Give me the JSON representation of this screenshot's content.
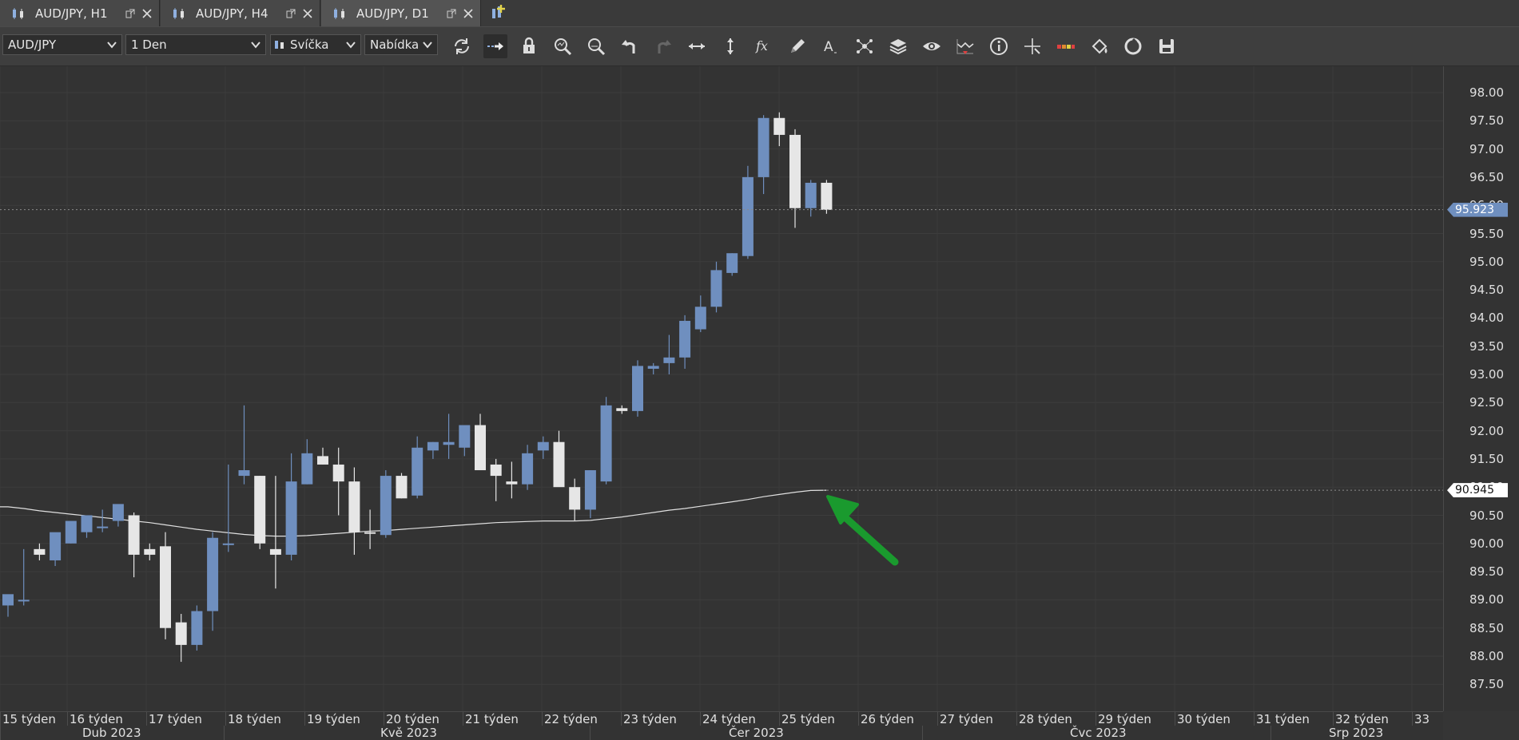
{
  "tabs": [
    {
      "label": "AUD/JPY, H1",
      "active": false
    },
    {
      "label": "AUD/JPY, H4",
      "active": false
    },
    {
      "label": "AUD/JPY, D1",
      "active": true
    }
  ],
  "toolbar": {
    "instrument": "AUD/JPY",
    "period": "1 Den",
    "chart_type": "Svíčka",
    "offer_side": "Nabídka",
    "tools": [
      "refresh-icon",
      "shift-chart-icon",
      "lock-icon",
      "zoom-in-icon",
      "zoom-out-icon",
      "undo-icon",
      "redo-icon",
      "horizontal-scale-icon",
      "vertical-scale-icon",
      "indicators-fx-icon",
      "drawing-pencil-icon",
      "text-tool-icon",
      "pattern-icon",
      "layers-icon",
      "visibility-eye-icon",
      "signals-icon",
      "info-icon",
      "crosshair-icon",
      "colors-icon",
      "theme-icon",
      "template-icon",
      "save-icon"
    ]
  },
  "price_axis": {
    "labels": [
      "98.00",
      "97.50",
      "97.00",
      "96.50",
      "96.00",
      "95.50",
      "95.00",
      "94.50",
      "94.00",
      "93.50",
      "93.00",
      "92.50",
      "92.00",
      "91.50",
      "91.00",
      "90.50",
      "90.00",
      "89.50",
      "89.00",
      "88.50",
      "88.00",
      "87.50"
    ],
    "current_price": "95.923",
    "ma_value": "90.945"
  },
  "time_axis": {
    "weeks": [
      "15 týden",
      "16 týden",
      "17 týden",
      "18 týden",
      "19 týden",
      "20 týden",
      "21 týden",
      "22 týden",
      "23 týden",
      "24 týden",
      "25 týden",
      "26 týden",
      "27 týden",
      "28 týden",
      "29 týden",
      "30 týden",
      "31 týden",
      "32 týden",
      "33"
    ],
    "months": [
      "Dub 2023",
      "Kvě 2023",
      "Čer 2023",
      "Čvc 2023",
      "Srp 2023"
    ]
  },
  "colors": {
    "bull": "#6f8fbf",
    "bear": "#e6e6e6",
    "ma_line": "#e0e0e0",
    "arrow": "#1a9a2e",
    "current_tag": "#6f8fbf"
  },
  "chart_data": {
    "type": "candlestick",
    "instrument": "AUD/JPY",
    "timeframe": "D1",
    "ylim": [
      87.25,
      98.3
    ],
    "ohlc": [
      [
        88.9,
        89.0,
        88.7,
        89.1
      ],
      [
        89.0,
        89.9,
        88.9,
        89.0
      ],
      [
        89.9,
        90.0,
        89.7,
        89.8
      ],
      [
        89.7,
        90.1,
        89.6,
        90.2
      ],
      [
        90.0,
        90.2,
        90.0,
        90.4
      ],
      [
        90.2,
        90.5,
        90.1,
        90.5
      ],
      [
        90.3,
        90.6,
        90.2,
        90.3
      ],
      [
        90.4,
        90.5,
        90.3,
        90.7
      ],
      [
        90.5,
        90.55,
        89.4,
        89.8
      ],
      [
        89.8,
        90.0,
        89.7,
        89.9
      ],
      [
        89.95,
        90.2,
        88.3,
        88.5
      ],
      [
        88.6,
        88.75,
        87.9,
        88.2
      ],
      [
        88.2,
        88.9,
        88.1,
        88.8
      ],
      [
        88.8,
        90.2,
        88.45,
        90.1
      ],
      [
        90.0,
        91.4,
        89.85,
        90.0
      ],
      [
        91.3,
        92.45,
        91.05,
        91.2
      ],
      [
        91.2,
        91.2,
        89.9,
        90.0
      ],
      [
        89.8,
        91.2,
        89.2,
        89.9
      ],
      [
        89.8,
        91.6,
        89.7,
        91.1
      ],
      [
        91.05,
        91.85,
        91.05,
        91.6
      ],
      [
        91.55,
        91.7,
        91.4,
        91.4
      ],
      [
        91.4,
        91.7,
        90.5,
        91.1
      ],
      [
        91.1,
        91.35,
        89.8,
        90.2
      ],
      [
        90.2,
        90.6,
        89.9,
        90.2
      ],
      [
        90.15,
        91.3,
        90.1,
        91.2
      ],
      [
        91.2,
        91.25,
        90.8,
        90.8
      ],
      [
        90.85,
        91.9,
        90.8,
        91.7
      ],
      [
        91.65,
        91.8,
        91.5,
        91.8
      ],
      [
        91.8,
        92.3,
        91.5,
        91.75
      ],
      [
        91.7,
        91.95,
        91.55,
        92.1
      ],
      [
        92.1,
        92.3,
        91.7,
        91.3
      ],
      [
        91.4,
        91.5,
        90.75,
        91.2
      ],
      [
        91.1,
        91.45,
        90.8,
        91.05
      ],
      [
        91.05,
        91.75,
        90.95,
        91.6
      ],
      [
        91.65,
        91.9,
        91.5,
        91.8
      ],
      [
        91.8,
        92.0,
        91.6,
        91.0
      ],
      [
        91.0,
        91.15,
        90.4,
        90.6
      ],
      [
        90.6,
        91.3,
        90.45,
        91.3
      ],
      [
        91.1,
        92.6,
        91.05,
        92.45
      ],
      [
        92.4,
        92.45,
        92.3,
        92.35
      ],
      [
        92.35,
        93.25,
        92.25,
        93.15
      ],
      [
        93.1,
        93.2,
        93.0,
        93.15
      ],
      [
        93.2,
        93.7,
        93.0,
        93.3
      ],
      [
        93.3,
        94.05,
        93.1,
        93.95
      ],
      [
        93.8,
        94.4,
        93.75,
        94.2
      ],
      [
        94.2,
        95.0,
        94.1,
        94.85
      ],
      [
        94.8,
        95.15,
        94.75,
        95.15
      ],
      [
        95.1,
        96.7,
        95.05,
        96.5
      ],
      [
        96.5,
        97.6,
        96.2,
        97.55
      ],
      [
        97.55,
        97.65,
        97.05,
        97.25
      ],
      [
        97.25,
        97.35,
        95.6,
        95.95
      ],
      [
        95.95,
        96.45,
        95.8,
        96.4
      ],
      [
        96.4,
        96.45,
        95.85,
        95.92
      ]
    ],
    "bull_flags": [
      1,
      1,
      0,
      1,
      1,
      1,
      1,
      1,
      0,
      0,
      0,
      0,
      1,
      1,
      1,
      1,
      0,
      0,
      1,
      1,
      0,
      0,
      0,
      0,
      1,
      0,
      1,
      1,
      1,
      1,
      0,
      0,
      0,
      1,
      1,
      0,
      0,
      1,
      1,
      0,
      1,
      1,
      1,
      1,
      1,
      1,
      1,
      1,
      1,
      0,
      0,
      1,
      0
    ],
    "ma": {
      "name": "",
      "values": [
        90.65,
        90.62,
        90.58,
        90.55,
        90.52,
        90.49,
        90.46,
        90.43,
        90.4,
        90.37,
        90.33,
        90.29,
        90.25,
        90.22,
        90.19,
        90.16,
        90.14,
        90.13,
        90.13,
        90.14,
        90.16,
        90.18,
        90.2,
        90.22,
        90.23,
        90.25,
        90.27,
        90.29,
        90.31,
        90.33,
        90.35,
        90.37,
        90.38,
        90.39,
        90.4,
        90.4,
        90.4,
        90.41,
        90.44,
        90.47,
        90.51,
        90.55,
        90.59,
        90.62,
        90.66,
        90.7,
        90.74,
        90.78,
        90.83,
        90.87,
        90.91,
        90.94,
        90.945
      ]
    },
    "current_price": 95.923,
    "ma_last": 90.945
  }
}
